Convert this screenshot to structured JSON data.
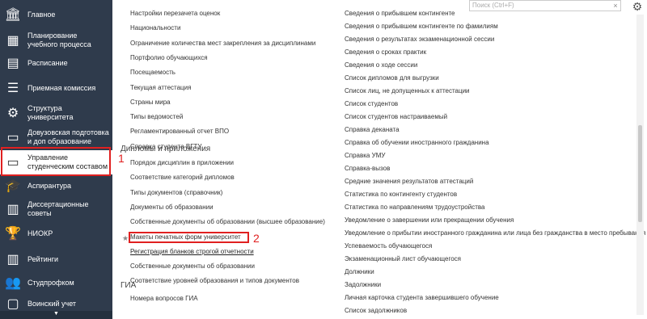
{
  "sidebar": {
    "items": [
      {
        "icon": "bank-icon",
        "glyph": "🏛",
        "label": "Главное"
      },
      {
        "icon": "calendar-icon",
        "glyph": "▦",
        "label": "Планирование учебного процесса"
      },
      {
        "icon": "schedule-icon",
        "glyph": "▤",
        "label": "Расписание"
      },
      {
        "icon": "list-icon",
        "glyph": "☰",
        "label": "Приемная комиссия"
      },
      {
        "icon": "structure-icon",
        "glyph": "⚙",
        "label": "Структура университета"
      },
      {
        "icon": "monitor-icon",
        "glyph": "▭",
        "label": "Довузовская подготовка и доп образование"
      },
      {
        "icon": "folder-icon",
        "glyph": "▭",
        "label": "Управление студенческим составом"
      },
      {
        "icon": "graduation-cap-icon",
        "glyph": "🎓",
        "label": "Аспирантура"
      },
      {
        "icon": "book-icon",
        "glyph": "▥",
        "label": "Диссертационные советы"
      },
      {
        "icon": "trophy-icon",
        "glyph": "🏆",
        "label": "НИОКР"
      },
      {
        "icon": "bar-chart-icon",
        "glyph": "▥",
        "label": "Рейтинги"
      },
      {
        "icon": "people-icon",
        "glyph": "👥",
        "label": "Студпрофком"
      },
      {
        "icon": "military-icon",
        "glyph": "▢",
        "label": "Воинский учет"
      }
    ],
    "bottom_arrow": "▼"
  },
  "annotations": {
    "label1": "1",
    "label2": "2"
  },
  "search": {
    "placeholder": "Поиск (Ctrl+F)",
    "button": "×"
  },
  "gear_glyph": "⚙",
  "left_column": {
    "links_top": [
      "Настройки перезачета оценок",
      "Национальности",
      "Ограничение количества мест закрепления за дисциплинами",
      "Портфолио обучающихся",
      "Посещаемость",
      "Текущая аттестация",
      "Страны мира",
      "Типы ведомостей",
      "Регламентированный отчет ВПО",
      "Справка студента ВГТУ"
    ],
    "section_diplomas": "Дипломы и приложения",
    "links_diplomas": [
      "Порядок дисциплин в приложении",
      "Соответствие категорий дипломов",
      "Типы документов (справочник)",
      "Документы об образовании",
      "Собственные документы об образовании (высшее образование)",
      "Макеты печатных форм университет",
      "Регистрация бланков строгой отчетности",
      "Собственные документы об образовании",
      "Соответствие уровней образования и типов документов"
    ],
    "section_gia": "ГИА",
    "links_gia": [
      "Номера вопросов ГИА"
    ]
  },
  "right_column": {
    "links": [
      "Сведения о прибывшем контингенте",
      "Сведения о прибывшем контингенте по фамилиям",
      "Сведения о результатах экзаменационной сессии",
      "Сведения о сроках практик",
      "Сведения о ходе сессии",
      "Список дипломов для выгрузки",
      "Список лиц, не допущенных к аттестации",
      "Список студентов",
      "Список студентов настраиваемый",
      "Справка деканата",
      "Справка об обучении иностранного гражданина",
      "Справка УМУ",
      "Справка-вызов",
      "Средние значения результатов аттестаций",
      "Статистика по контингенту студентов",
      "Статистика по направлениям трудоустройства",
      "Уведомление о завершении или прекращении обучения",
      "Уведомление о прибытии иностранного гражданина или лица без гражданства в место пребывания",
      "Успеваемость обучающегося",
      "Экзаменационный лист обучающегося",
      "Должники",
      "Задолжники",
      "Личная карточка студента завершившего обучение",
      "Список задолжников"
    ]
  }
}
